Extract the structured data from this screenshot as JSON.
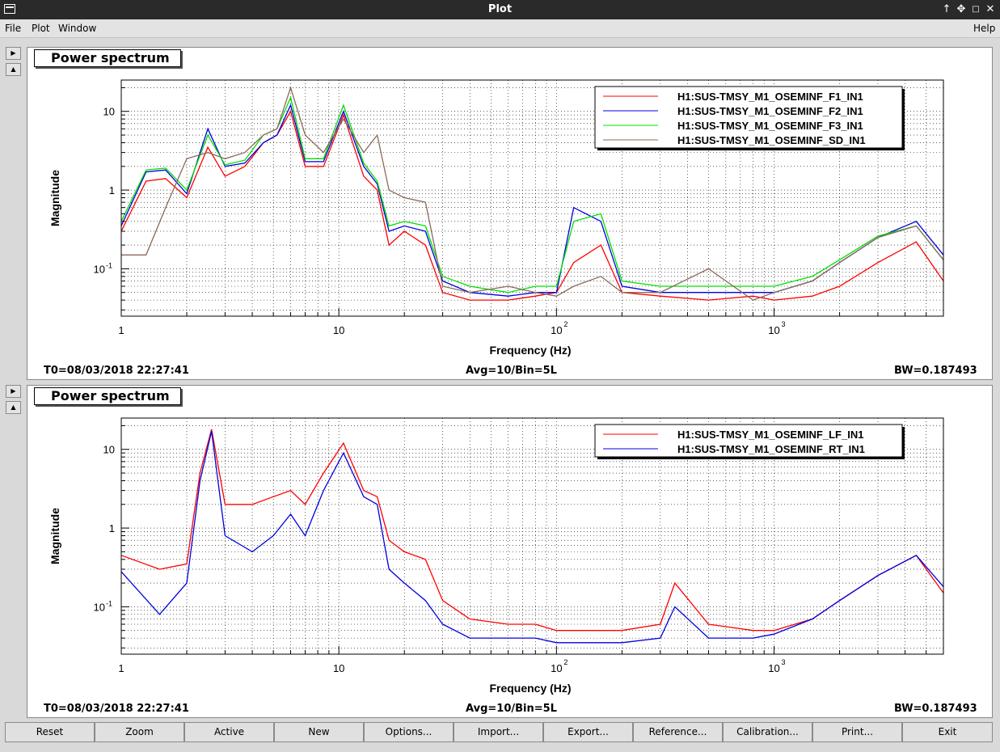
{
  "window": {
    "title": "Plot"
  },
  "menu": {
    "file": "File",
    "plot": "Plot",
    "window": "Window",
    "help": "Help"
  },
  "colors": {
    "f1": "#ff0000",
    "f2": "#0000e0",
    "f3": "#00e000",
    "sd": "#8b6a5a"
  },
  "panels": [
    {
      "title": "Power spectrum",
      "xlabel": "Frequency (Hz)",
      "ylabel": "Magnitude",
      "status_left": "T0=08/03/2018 22:27:41",
      "status_mid": "Avg=10/Bin=5L",
      "status_right": "BW=0.187493",
      "x_ticks": [
        "1",
        "10",
        "10",
        "10"
      ],
      "y_ticks": [
        "10",
        "1",
        "10"
      ]
    },
    {
      "title": "Power spectrum",
      "xlabel": "Frequency (Hz)",
      "ylabel": "Magnitude",
      "status_left": "T0=08/03/2018 22:27:41",
      "status_mid": "Avg=10/Bin=5L",
      "status_right": "BW=0.187493",
      "x_ticks": [
        "1",
        "10",
        "10",
        "10"
      ],
      "y_ticks": [
        "10",
        "1",
        "10"
      ]
    }
  ],
  "toolbar": [
    "Reset",
    "Zoom",
    "Active",
    "New",
    "Options...",
    "Import...",
    "Export...",
    "Reference...",
    "Calibration...",
    "Print...",
    "Exit"
  ],
  "chart_data": [
    {
      "type": "line",
      "title": "Power spectrum",
      "xlabel": "Frequency (Hz)",
      "ylabel": "Magnitude",
      "xscale": "log",
      "yscale": "log",
      "xlim": [
        1,
        6000
      ],
      "ylim": [
        0.025,
        25
      ],
      "grid": true,
      "legend": "top-right",
      "series": [
        {
          "name": "H1:SUS-TMSY_M1_OSEMINF_F1_IN1",
          "color": "#ff0000",
          "x": [
            1,
            1.3,
            1.6,
            2,
            2.5,
            3,
            3.7,
            4.5,
            5.2,
            6,
            7,
            8.5,
            10.5,
            13,
            15,
            17,
            20,
            25,
            30,
            40,
            60,
            80,
            100,
            120,
            160,
            200,
            300,
            500,
            800,
            1000,
            1500,
            2000,
            3000,
            4500,
            6000
          ],
          "y": [
            0.3,
            1.3,
            1.4,
            0.8,
            3.5,
            1.5,
            2.0,
            4.0,
            5.0,
            10.0,
            2.0,
            2.0,
            9.0,
            1.5,
            1.0,
            0.2,
            0.3,
            0.2,
            0.05,
            0.04,
            0.04,
            0.045,
            0.05,
            0.12,
            0.2,
            0.05,
            0.045,
            0.04,
            0.045,
            0.04,
            0.045,
            0.06,
            0.12,
            0.22,
            0.07
          ]
        },
        {
          "name": "H1:SUS-TMSY_M1_OSEMINF_F2_IN1",
          "color": "#0000e0",
          "x": [
            1,
            1.3,
            1.6,
            2,
            2.5,
            3,
            3.7,
            4.5,
            5.2,
            6,
            7,
            8.5,
            10.5,
            13,
            15,
            17,
            20,
            25,
            30,
            40,
            60,
            80,
            100,
            120,
            160,
            200,
            300,
            500,
            800,
            1000,
            1500,
            2000,
            3000,
            4500,
            6000
          ],
          "y": [
            0.35,
            1.7,
            1.8,
            0.9,
            6.0,
            2.0,
            2.2,
            4.0,
            5.0,
            12.0,
            2.3,
            2.3,
            10.0,
            2.0,
            1.2,
            0.3,
            0.35,
            0.3,
            0.07,
            0.05,
            0.045,
            0.05,
            0.05,
            0.6,
            0.4,
            0.06,
            0.05,
            0.05,
            0.05,
            0.05,
            0.07,
            0.12,
            0.25,
            0.4,
            0.15
          ]
        },
        {
          "name": "H1:SUS-TMSY_M1_OSEMINF_F3_IN1",
          "color": "#00e000",
          "x": [
            1,
            1.3,
            1.6,
            2,
            2.5,
            3,
            3.7,
            4.5,
            5.2,
            6,
            7,
            8.5,
            10.5,
            13,
            15,
            17,
            20,
            25,
            30,
            40,
            60,
            80,
            100,
            120,
            160,
            200,
            300,
            500,
            800,
            1000,
            1500,
            2000,
            3000,
            4500,
            6000
          ],
          "y": [
            0.4,
            1.8,
            1.9,
            1.0,
            5.0,
            2.1,
            2.4,
            5.0,
            6.0,
            15.0,
            2.5,
            2.5,
            12.0,
            2.2,
            1.3,
            0.35,
            0.4,
            0.35,
            0.08,
            0.06,
            0.05,
            0.06,
            0.06,
            0.4,
            0.5,
            0.07,
            0.06,
            0.06,
            0.06,
            0.06,
            0.08,
            0.13,
            0.26,
            0.35,
            0.13
          ]
        },
        {
          "name": "H1:SUS-TMSY_M1_OSEMINF_SD_IN1",
          "color": "#8b6a5a",
          "x": [
            1,
            1.3,
            1.6,
            2,
            2.5,
            3,
            3.7,
            4.5,
            5.2,
            6,
            7,
            8.5,
            10.5,
            13,
            15,
            17,
            20,
            25,
            30,
            40,
            60,
            80,
            100,
            120,
            160,
            200,
            300,
            500,
            800,
            1000,
            1500,
            2000,
            3000,
            4500,
            6000
          ],
          "y": [
            0.15,
            0.15,
            0.6,
            2.5,
            3.0,
            2.5,
            3.0,
            5.0,
            6.0,
            20.0,
            5.0,
            3.0,
            8.0,
            3.0,
            5.0,
            1.0,
            0.8,
            0.7,
            0.06,
            0.05,
            0.06,
            0.05,
            0.045,
            0.06,
            0.08,
            0.05,
            0.05,
            0.1,
            0.04,
            0.05,
            0.07,
            0.12,
            0.25,
            0.35,
            0.13
          ]
        }
      ]
    },
    {
      "type": "line",
      "title": "Power spectrum",
      "xlabel": "Frequency (Hz)",
      "ylabel": "Magnitude",
      "xscale": "log",
      "yscale": "log",
      "xlim": [
        1,
        6000
      ],
      "ylim": [
        0.025,
        25
      ],
      "grid": true,
      "legend": "top-right",
      "series": [
        {
          "name": "H1:SUS-TMSY_M1_OSEMINF_LF_IN1",
          "color": "#ff0000",
          "x": [
            1,
            1.5,
            2,
            2.3,
            2.6,
            3,
            4,
            5,
            6,
            7,
            8.5,
            10.5,
            13,
            15,
            17,
            20,
            25,
            30,
            40,
            60,
            80,
            100,
            150,
            200,
            300,
            350,
            500,
            800,
            1000,
            1500,
            2000,
            3000,
            4500,
            6000
          ],
          "y": [
            0.45,
            0.3,
            0.35,
            5.0,
            18.0,
            2.0,
            2.0,
            2.5,
            3.0,
            2.0,
            5.0,
            12.0,
            3.0,
            2.5,
            0.7,
            0.5,
            0.4,
            0.12,
            0.07,
            0.06,
            0.06,
            0.05,
            0.05,
            0.05,
            0.06,
            0.2,
            0.06,
            0.05,
            0.05,
            0.07,
            0.12,
            0.25,
            0.45,
            0.15
          ]
        },
        {
          "name": "H1:SUS-TMSY_M1_OSEMINF_RT_IN1",
          "color": "#0000e0",
          "x": [
            1,
            1.5,
            2,
            2.3,
            2.6,
            3,
            4,
            5,
            6,
            7,
            8.5,
            10.5,
            13,
            15,
            17,
            20,
            25,
            30,
            40,
            60,
            80,
            100,
            150,
            200,
            300,
            350,
            500,
            800,
            1000,
            1500,
            2000,
            3000,
            4500,
            6000
          ],
          "y": [
            0.28,
            0.08,
            0.2,
            4.0,
            17.0,
            0.8,
            0.5,
            0.8,
            1.5,
            0.8,
            3.0,
            9.0,
            2.5,
            2.0,
            0.3,
            0.2,
            0.12,
            0.06,
            0.04,
            0.04,
            0.04,
            0.035,
            0.035,
            0.035,
            0.04,
            0.1,
            0.04,
            0.04,
            0.045,
            0.07,
            0.12,
            0.25,
            0.45,
            0.18
          ]
        }
      ]
    }
  ]
}
